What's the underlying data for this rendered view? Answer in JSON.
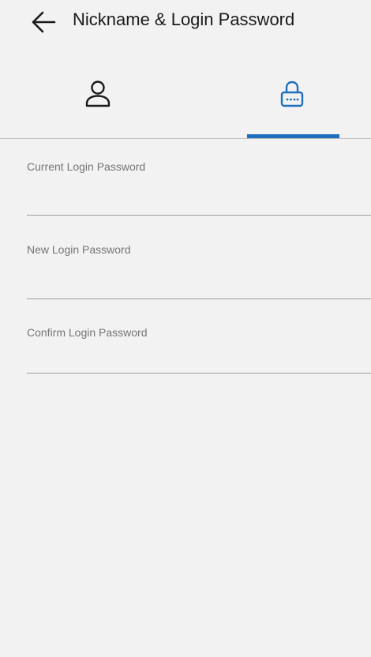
{
  "header": {
    "title": "Nickname & Login Password",
    "back_icon": "arrow-left-icon"
  },
  "tabs": [
    {
      "id": "nickname",
      "icon": "user-icon",
      "selected": false
    },
    {
      "id": "password",
      "icon": "lock-icon",
      "selected": true
    }
  ],
  "form": {
    "current_password": {
      "label": "Current Login Password",
      "value": ""
    },
    "new_password": {
      "label": "New Login Password",
      "value": ""
    },
    "confirm_password": {
      "label": "Confirm Login Password",
      "value": ""
    }
  },
  "colors": {
    "accent": "#1e6fc0",
    "background": "#f2f2f2",
    "text": "#1a1a1a",
    "label": "#757575"
  }
}
